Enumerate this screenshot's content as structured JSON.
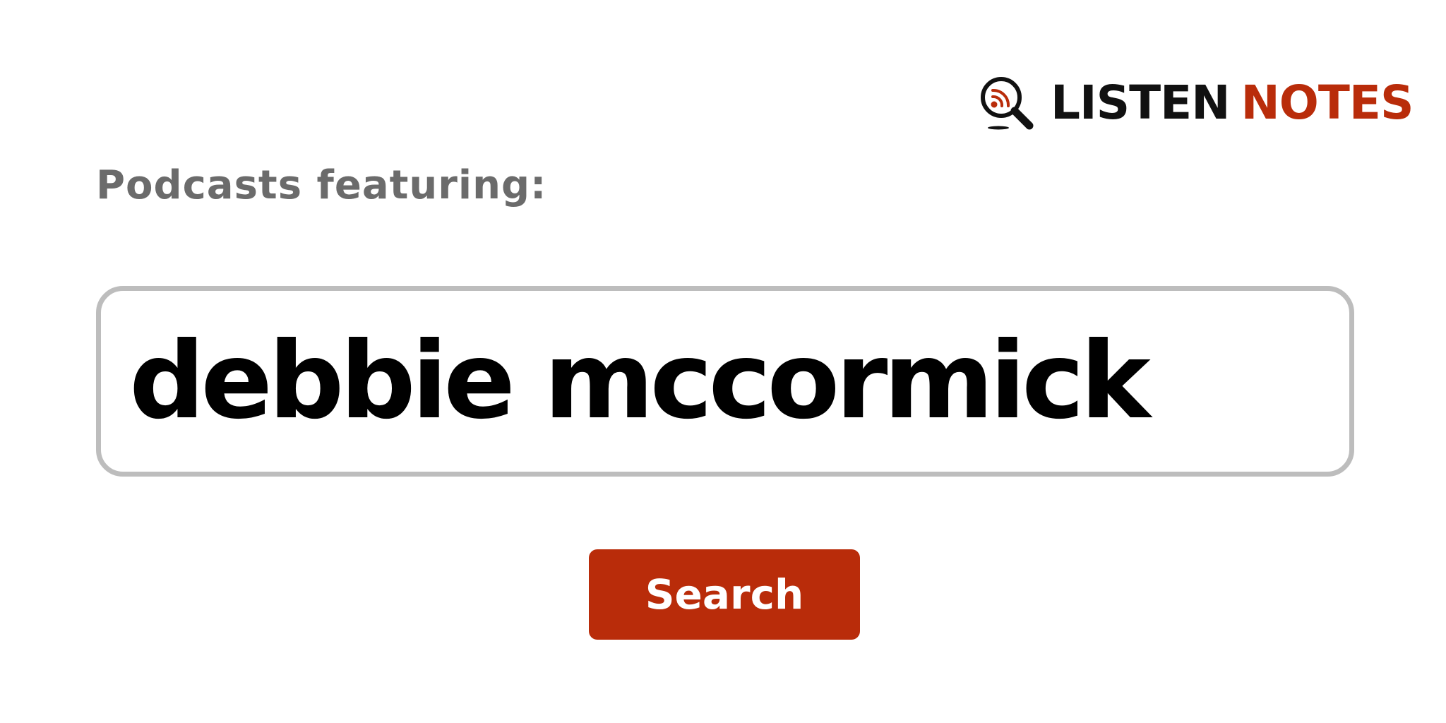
{
  "brand": {
    "icon": "podcast-search-icon",
    "name_part_1": "LISTEN",
    "name_part_2": "NOTES",
    "colors": {
      "dark": "#111111",
      "accent": "#b92c0a"
    }
  },
  "heading": "Podcasts featuring:",
  "search": {
    "value": "debbie mccormick",
    "border_color": "#bdbdbd"
  },
  "search_button": {
    "label": "Search",
    "color": "#b92c0a"
  }
}
